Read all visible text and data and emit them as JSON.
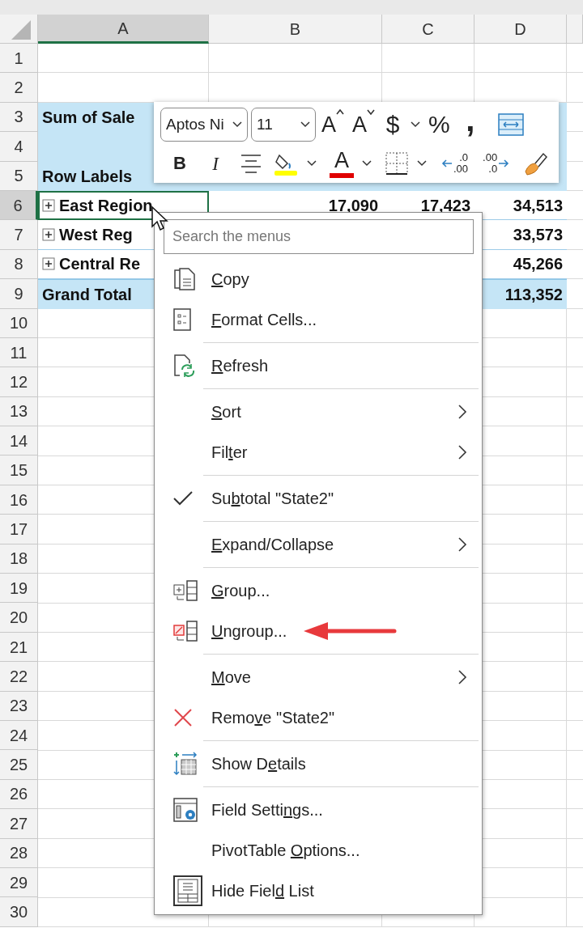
{
  "sheet": {
    "columns": [
      {
        "label": "A",
        "selected": true
      },
      {
        "label": "B",
        "selected": false
      },
      {
        "label": "C",
        "selected": false
      },
      {
        "label": "D",
        "selected": false
      }
    ],
    "rows": [
      {
        "number": "1",
        "selected": false
      },
      {
        "number": "2",
        "selected": false
      },
      {
        "number": "3",
        "selected": false,
        "kind": "header",
        "cells": {
          "a": "Sum of Sale"
        }
      },
      {
        "number": "4",
        "selected": false,
        "kind": "header",
        "cells": {}
      },
      {
        "number": "5",
        "selected": false,
        "kind": "header",
        "cells": {
          "a": "Row Labels"
        }
      },
      {
        "number": "6",
        "selected": true,
        "kind": "item",
        "expanded": false,
        "cells": {
          "a": "East Region",
          "b": "17,090",
          "c": "17,423",
          "d": "34,513"
        }
      },
      {
        "number": "7",
        "selected": false,
        "kind": "item",
        "expanded": false,
        "cells": {
          "a": "West Reg",
          "d": "33,573"
        }
      },
      {
        "number": "8",
        "selected": false,
        "kind": "item",
        "expanded": false,
        "cells": {
          "a": "Central Re",
          "d": "45,266"
        }
      },
      {
        "number": "9",
        "selected": false,
        "kind": "total",
        "cells": {
          "a": "Grand Total",
          "d": "113,352"
        }
      },
      {
        "number": "10",
        "selected": false
      },
      {
        "number": "11",
        "selected": false
      },
      {
        "number": "12",
        "selected": false
      },
      {
        "number": "13",
        "selected": false
      },
      {
        "number": "14",
        "selected": false
      },
      {
        "number": "15",
        "selected": false
      },
      {
        "number": "16",
        "selected": false
      },
      {
        "number": "17",
        "selected": false
      },
      {
        "number": "18",
        "selected": false
      },
      {
        "number": "19",
        "selected": false
      },
      {
        "number": "20",
        "selected": false
      },
      {
        "number": "21",
        "selected": false
      },
      {
        "number": "22",
        "selected": false
      },
      {
        "number": "23",
        "selected": false
      },
      {
        "number": "24",
        "selected": false
      },
      {
        "number": "25",
        "selected": false
      },
      {
        "number": "26",
        "selected": false
      },
      {
        "number": "27",
        "selected": false
      },
      {
        "number": "28",
        "selected": false
      },
      {
        "number": "29",
        "selected": false
      },
      {
        "number": "30",
        "selected": false
      }
    ]
  },
  "mini_toolbar": {
    "font_name": "Aptos Ni",
    "font_size": "11",
    "row_1": [
      {
        "kind": "grow",
        "label": "A",
        "dropdown": false
      },
      {
        "kind": "shrink",
        "label": "A",
        "dropdown": false
      },
      {
        "kind": "currency",
        "label": "$",
        "dropdown": true
      },
      {
        "kind": "percent",
        "label": "%",
        "dropdown": false
      },
      {
        "kind": "comma",
        "label": ",",
        "dropdown": false
      },
      {
        "kind": "wrap",
        "dropdown": false
      }
    ],
    "row_2": [
      {
        "kind": "bold",
        "label": "B",
        "dropdown": false
      },
      {
        "kind": "italic",
        "label": "I",
        "dropdown": false
      },
      {
        "kind": "center",
        "dropdown": false
      },
      {
        "kind": "fill",
        "dropdown": true,
        "color": "#ffff00"
      },
      {
        "kind": "font_color",
        "label": "A",
        "dropdown": true,
        "color": "#e00000"
      },
      {
        "kind": "borders",
        "dropdown": true
      },
      {
        "kind": "decrease_decimal",
        "lines": [
          ".0",
          ".00"
        ],
        "dropdown": false
      },
      {
        "kind": "increase_decimal",
        "lines": [
          ".00",
          ".0"
        ],
        "dropdown": false
      },
      {
        "kind": "painter",
        "dropdown": false
      }
    ]
  },
  "context_menu": {
    "search": {
      "placeholder": "Search the menus"
    },
    "items": [
      {
        "kind": "copy",
        "label": {
          "key": "C",
          "after": "opy"
        },
        "checked": false,
        "submenu": false,
        "separator_after": false,
        "annotated": false
      },
      {
        "kind": "format",
        "label": {
          "key": "F",
          "after": "ormat Cells..."
        },
        "checked": false,
        "submenu": false,
        "separator_after": true,
        "annotated": false
      },
      {
        "kind": "refresh",
        "label": {
          "key": "R",
          "after": "efresh"
        },
        "checked": false,
        "submenu": false,
        "separator_after": true,
        "annotated": false
      },
      {
        "kind": "plain",
        "label": {
          "key": "S",
          "after": "ort"
        },
        "checked": false,
        "submenu": true,
        "separator_after": false,
        "annotated": false
      },
      {
        "kind": "plain",
        "label": {
          "before": "Fil",
          "key": "t",
          "after": "er"
        },
        "checked": false,
        "submenu": true,
        "separator_after": true,
        "annotated": false
      },
      {
        "kind": "plain",
        "label": {
          "before": "Su",
          "key": "b",
          "after": "total \"State2\""
        },
        "checked": true,
        "submenu": false,
        "separator_after": true,
        "annotated": false
      },
      {
        "kind": "plain",
        "label": {
          "key": "E",
          "after": "xpand/Collapse"
        },
        "checked": false,
        "submenu": true,
        "separator_after": true,
        "annotated": false
      },
      {
        "kind": "group",
        "label": {
          "key": "G",
          "after": "roup..."
        },
        "checked": false,
        "submenu": false,
        "separator_after": false,
        "annotated": false
      },
      {
        "kind": "ungroup",
        "label": {
          "key": "U",
          "after": "ngroup..."
        },
        "checked": false,
        "submenu": false,
        "separator_after": true,
        "annotated": true
      },
      {
        "kind": "plain",
        "label": {
          "key": "M",
          "after": "ove"
        },
        "checked": false,
        "submenu": true,
        "separator_after": false,
        "annotated": false
      },
      {
        "kind": "remove",
        "label": {
          "before": "Remo",
          "key": "v",
          "after": "e \"State2\""
        },
        "checked": false,
        "submenu": false,
        "separator_after": true,
        "annotated": false
      },
      {
        "kind": "details",
        "label": {
          "before": "Show D",
          "key": "e",
          "after": "tails"
        },
        "checked": false,
        "submenu": false,
        "separator_after": true,
        "annotated": false
      },
      {
        "kind": "settings",
        "label": {
          "before": "Field Setti",
          "key": "n",
          "after": "gs..."
        },
        "checked": false,
        "submenu": false,
        "separator_after": false,
        "annotated": false
      },
      {
        "kind": "plain",
        "label": {
          "before": "PivotTable ",
          "key": "O",
          "after": "ptions..."
        },
        "checked": false,
        "submenu": false,
        "separator_after": false,
        "annotated": false
      },
      {
        "kind": "field_list",
        "label": {
          "before": "Hide Fiel",
          "key": "d",
          "after": " List"
        },
        "checked": false,
        "submenu": false,
        "separator_after": false,
        "annotated": false
      }
    ]
  }
}
